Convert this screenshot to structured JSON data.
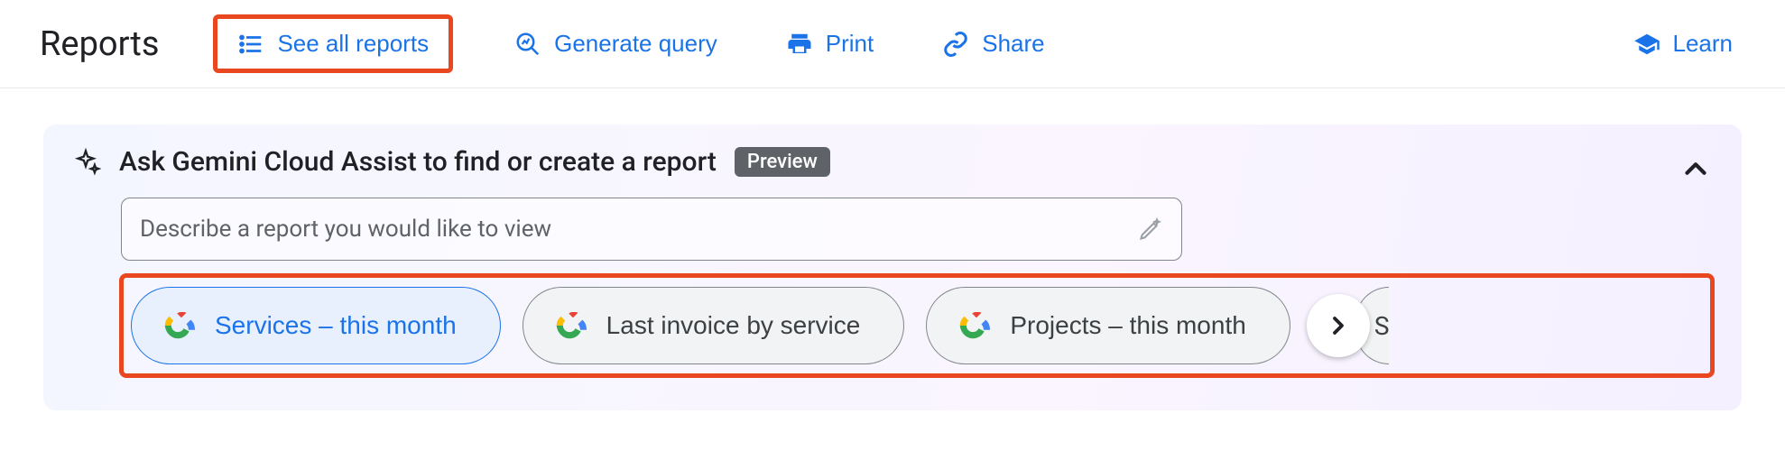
{
  "header": {
    "title": "Reports",
    "actions": {
      "see_all": "See all reports",
      "generate_query": "Generate query",
      "print": "Print",
      "share": "Share",
      "learn": "Learn"
    }
  },
  "panel": {
    "title": "Ask Gemini Cloud Assist to find or create a report",
    "badge": "Preview",
    "input_placeholder": "Describe a report you would like to view",
    "chips": [
      "Services – this month",
      "Last invoice by service",
      "Projects – this month"
    ],
    "next_chip_peek": "S"
  }
}
